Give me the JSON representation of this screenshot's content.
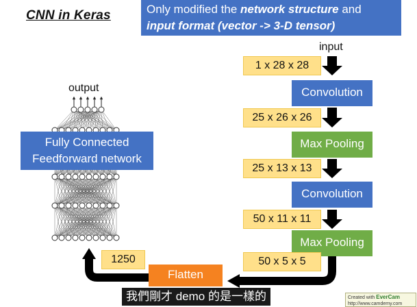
{
  "title": "CNN in Keras",
  "note": {
    "line1_prefix": "Only modified the ",
    "line1_em": "network structure",
    "line1_suffix": " and",
    "line2_em": "input format (vector -> 3-D tensor)"
  },
  "labels": {
    "input": "input",
    "output": "output"
  },
  "dims": {
    "d1": "1 x 28 x 28",
    "d2": "25 x 26 x 26",
    "d3": "25 x 13 x 13",
    "d4": "50 x 11 x 11",
    "d5": "50 x 5 x 5",
    "flat": "1250"
  },
  "layers": {
    "conv1": "Convolution",
    "pool1": "Max Pooling",
    "conv2": "Convolution",
    "pool2": "Max Pooling",
    "flatten": "Flatten"
  },
  "fc": {
    "line1": "Fully Connected",
    "line2": "Feedforward network"
  },
  "subtitle": "我們剛才 demo 的是一樣的",
  "watermark": {
    "line1_prefix": "Created with ",
    "brand": "EverCam",
    "line2": "http://www.camdemy.com"
  },
  "colors": {
    "blue": "#4472c4",
    "green": "#70ad47",
    "orange": "#f58220",
    "yellow": "#ffe08a",
    "arrow": "#000000"
  }
}
